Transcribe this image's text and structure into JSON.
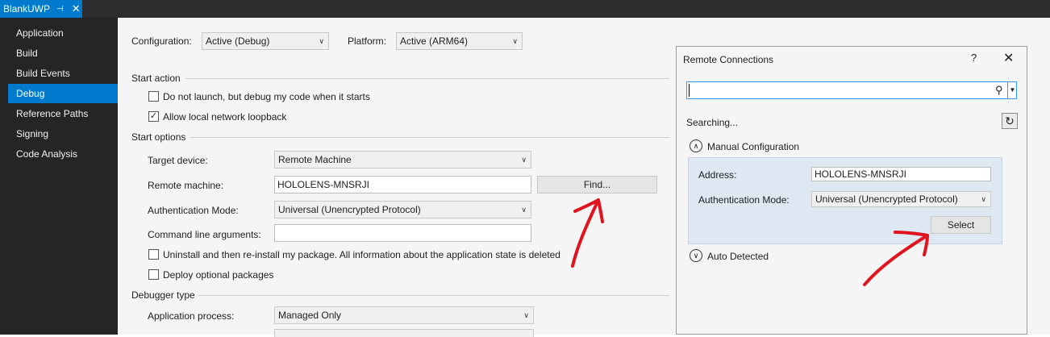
{
  "tab": {
    "title": "BlankUWP",
    "pin_icon": "pin-icon",
    "close_icon": "close-icon"
  },
  "nav": {
    "items": [
      "Application",
      "Build",
      "Build Events",
      "Debug",
      "Reference Paths",
      "Signing",
      "Code Analysis"
    ],
    "active": "Debug"
  },
  "config": {
    "configuration_label": "Configuration:",
    "configuration_value": "Active (Debug)",
    "platform_label": "Platform:",
    "platform_value": "Active (ARM64)"
  },
  "start_action": {
    "heading": "Start action",
    "dont_launch": "Do not launch, but debug my code when it starts",
    "allow_loopback": "Allow local network loopback"
  },
  "start_options": {
    "heading": "Start options",
    "target_device_label": "Target device:",
    "target_device_value": "Remote Machine",
    "remote_machine_label": "Remote machine:",
    "remote_machine_value": "HOLOLENS-MNSRJI",
    "find_button": "Find...",
    "auth_label": "Authentication Mode:",
    "auth_value": "Universal (Unencrypted Protocol)",
    "cmd_label": "Command line arguments:",
    "cmd_value": "",
    "uninstall": "Uninstall and then re-install my package. All information about the application state is deleted",
    "deploy_optional": "Deploy optional packages"
  },
  "debugger": {
    "heading": "Debugger type",
    "app_process_label": "Application process:",
    "app_process_value": "Managed Only"
  },
  "dialog": {
    "title": "Remote Connections",
    "help": "?",
    "close": "✕",
    "search_value": "",
    "searching": "Searching...",
    "manual_heading": "Manual Configuration",
    "address_label": "Address:",
    "address_value": "HOLOLENS-MNSRJI",
    "auth_label": "Authentication Mode:",
    "auth_value": "Universal (Unencrypted Protocol)",
    "select_button": "Select",
    "auto_heading": "Auto Detected"
  },
  "colors": {
    "accent": "#007acc",
    "annotation": "#e0141e",
    "nav_bg": "#252526"
  }
}
